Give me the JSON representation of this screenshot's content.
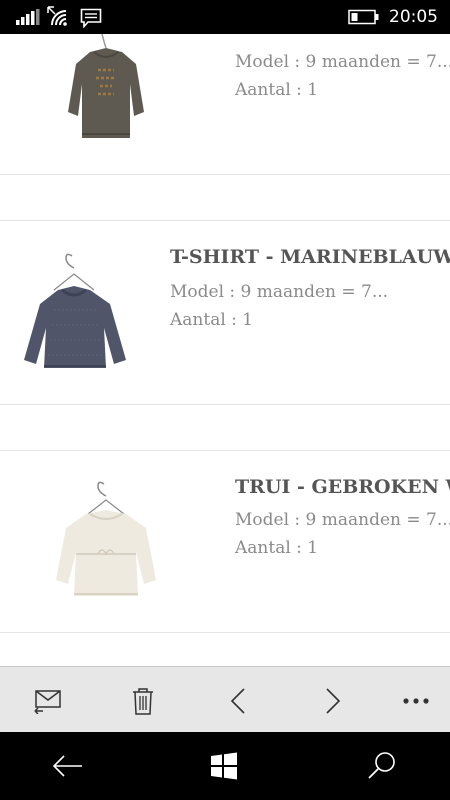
{
  "status_bar": {
    "time": "20:05",
    "icons": [
      "signal-icon",
      "wifi-icon",
      "message-icon",
      "battery-icon"
    ]
  },
  "items": [
    {
      "title": "",
      "model": "Model : 9 maanden = 7...",
      "quantity": "Aantal : 1",
      "image": "grey-long-sleeve-shirt"
    },
    {
      "title": "T-SHIRT - MARINEBLAUW",
      "model": "Model : 9 maanden = 7...",
      "quantity": "Aantal : 1",
      "image": "navy-long-sleeve-shirt"
    },
    {
      "title": "TRUI - GEBROKEN WIT",
      "model": "Model : 9 maanden = 7...",
      "quantity": "Aantal : 1",
      "image": "off-white-sweater"
    }
  ],
  "app_bar": {
    "buttons": [
      "reply-mail-icon",
      "delete-icon",
      "previous-icon",
      "next-icon",
      "more-icon"
    ]
  },
  "nav_bar": {
    "buttons": [
      "back-icon",
      "windows-start-icon",
      "search-icon"
    ]
  },
  "colors": {
    "content_background": "#ffffff",
    "app_bar_background": "#e7e7e7",
    "system_bar_background": "#000000",
    "title_text": "#555555",
    "detail_text": "#8a8a8a",
    "divider": "#e4e4e4"
  }
}
